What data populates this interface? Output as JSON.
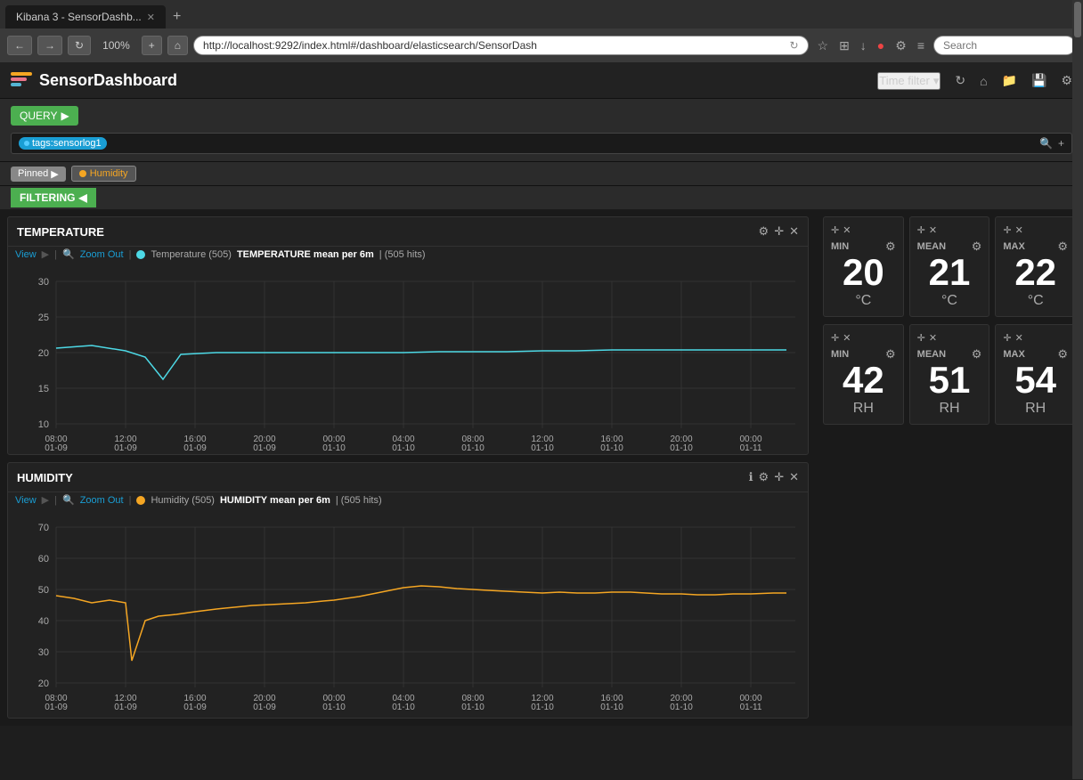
{
  "browser": {
    "tab_title": "Kibana 3 - SensorDashb...",
    "url": "http://localhost:9292/index.html#/dashboard/elasticsearch/SensorDash",
    "zoom": "100%",
    "search_placeholder": "Search"
  },
  "kibana": {
    "title": "SensorDashboard",
    "time_filter_label": "Time filter",
    "query_button": "QUERY",
    "query_tag": "tags:sensorlog1",
    "filter_pinned": "Pinned",
    "filter_humidity": "Humidity",
    "filtering_label": "FILTERING"
  },
  "temperature_panel": {
    "title": "TEMPERATURE",
    "toolbar_view": "View",
    "toolbar_zoom": "Zoom Out",
    "legend_label": "Temperature (505)",
    "description": "TEMPERATURE mean per 6m | (505 hits)",
    "y_labels": [
      "30",
      "25",
      "20",
      "15",
      "10"
    ],
    "x_labels": [
      "08:00\n01-09",
      "12:00\n01-09",
      "16:00\n01-09",
      "20:00\n01-09",
      "00:00\n01-10",
      "04:00\n01-10",
      "08:00\n01-10",
      "12:00\n01-10",
      "16:00\n01-10",
      "20:00\n01-10",
      "00:00\n01-11"
    ],
    "line_color": "#4dd9e6"
  },
  "temperature_stats": {
    "min": {
      "label": "MIN",
      "value": "20",
      "unit": "°C"
    },
    "mean": {
      "label": "MEAN",
      "value": "21",
      "unit": "°C"
    },
    "max": {
      "label": "MAX",
      "value": "22",
      "unit": "°C"
    }
  },
  "humidity_panel": {
    "title": "HUMIDITY",
    "toolbar_view": "View",
    "toolbar_zoom": "Zoom Out",
    "legend_label": "Humidity (505)",
    "description": "HUMIDITY mean per 6m | (505 hits)",
    "y_labels": [
      "70",
      "60",
      "50",
      "40",
      "30",
      "20"
    ],
    "x_labels": [
      "08:00\n01-09",
      "12:00\n01-09",
      "16:00\n01-09",
      "20:00\n01-09",
      "00:00\n01-10",
      "04:00\n01-10",
      "08:00\n01-10",
      "12:00\n01-10",
      "16:00\n01-10",
      "20:00\n01-10",
      "00:00\n01-11"
    ],
    "line_color": "#f5a623"
  },
  "humidity_stats": {
    "min": {
      "label": "MIN",
      "value": "42",
      "unit": "RH"
    },
    "mean": {
      "label": "MEAN",
      "value": "51",
      "unit": "RH"
    },
    "max": {
      "label": "MAX",
      "value": "54",
      "unit": "RH"
    }
  }
}
